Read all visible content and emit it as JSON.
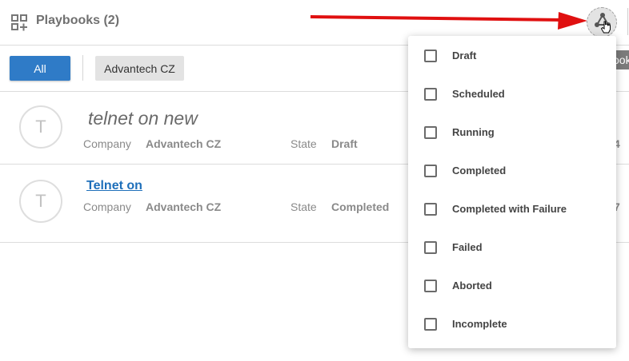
{
  "header": {
    "title": "Playbooks (2)",
    "grid_icon": "apps-add-icon",
    "add_label": "ook"
  },
  "toolbar": {
    "all_label": "All",
    "company_chip": "Advantech CZ",
    "primary_color": "#2f7bc7"
  },
  "rows": [
    {
      "avatar": "T",
      "name": "telnet on new",
      "company_label": "Company",
      "company": "Advantech CZ",
      "state_label": "State",
      "state": "Draft",
      "trailing": "4"
    },
    {
      "avatar": "T",
      "name": "Telnet on",
      "company_label": "Company",
      "company": "Advantech CZ",
      "state_label": "State",
      "state": "Completed",
      "trailing": "7"
    }
  ],
  "annotation": {
    "arrow_color": "#e01010",
    "cursor": "hand-pointer-icon"
  },
  "filter_menu": {
    "icon": "filter-triangle-icon",
    "items": [
      {
        "label": "Draft",
        "checked": false
      },
      {
        "label": "Scheduled",
        "checked": false
      },
      {
        "label": "Running",
        "checked": false
      },
      {
        "label": "Completed",
        "checked": false
      },
      {
        "label": "Completed with Failure",
        "checked": false
      },
      {
        "label": "Failed",
        "checked": false
      },
      {
        "label": "Aborted",
        "checked": false
      },
      {
        "label": "Incomplete",
        "checked": false
      }
    ]
  }
}
